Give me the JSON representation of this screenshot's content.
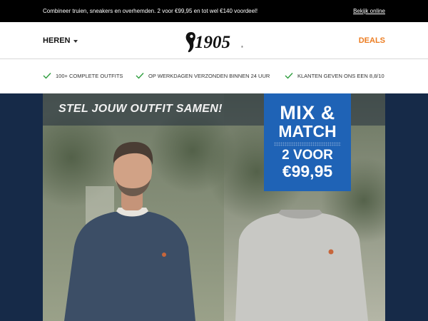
{
  "topbar": {
    "promo": "Combineer truien, sneakers en overhemden. 2 voor €99,95 en tot wel €140 voordeel!",
    "view_online": "Bekijk online"
  },
  "nav": {
    "left_menu": "HEREN",
    "logo_text": "1905",
    "right_link": "DEALS",
    "accent_color": "#ec7d22"
  },
  "usps": [
    {
      "icon": "check-icon",
      "text": "100+ COMPLETE OUTFITS"
    },
    {
      "icon": "check-icon",
      "text": "OP WERKDAGEN VERZONDEN BINNEN 24 UUR"
    },
    {
      "icon": "check-icon",
      "text": "KLANTEN GEVEN ONS EEN 8,8/10"
    }
  ],
  "banner": {
    "headline": "STEL JOUW OUTFIT SAMEN!",
    "mix_line1": "MIX &",
    "mix_line2": "MATCH",
    "mix_line3": "2 VOOR",
    "mix_line4": "€99,95",
    "badge_color": "#1f63b6",
    "background_color": "#162a48"
  }
}
